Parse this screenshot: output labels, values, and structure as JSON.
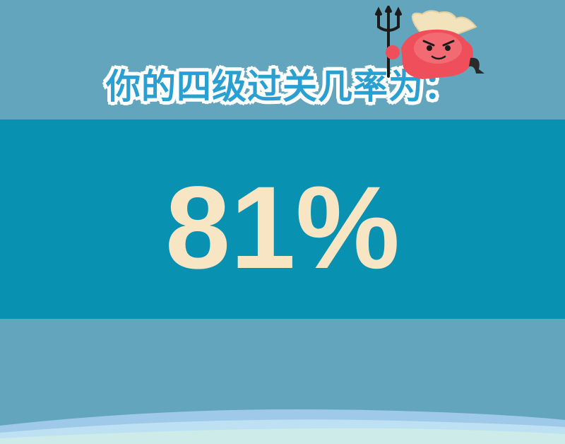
{
  "headline": "你的四级过关几率为：",
  "result": {
    "pass_rate": "81%"
  },
  "colors": {
    "background": "#63a5bd",
    "band": "#0891b0",
    "headline": "#2a9fd1",
    "percent": "#f7e5c3",
    "mascot_body": "#ef4f5a",
    "mascot_horns": "#f2e3bd"
  },
  "icons": {
    "mascot": "devil-mascot-icon",
    "trident": "trident-icon"
  }
}
